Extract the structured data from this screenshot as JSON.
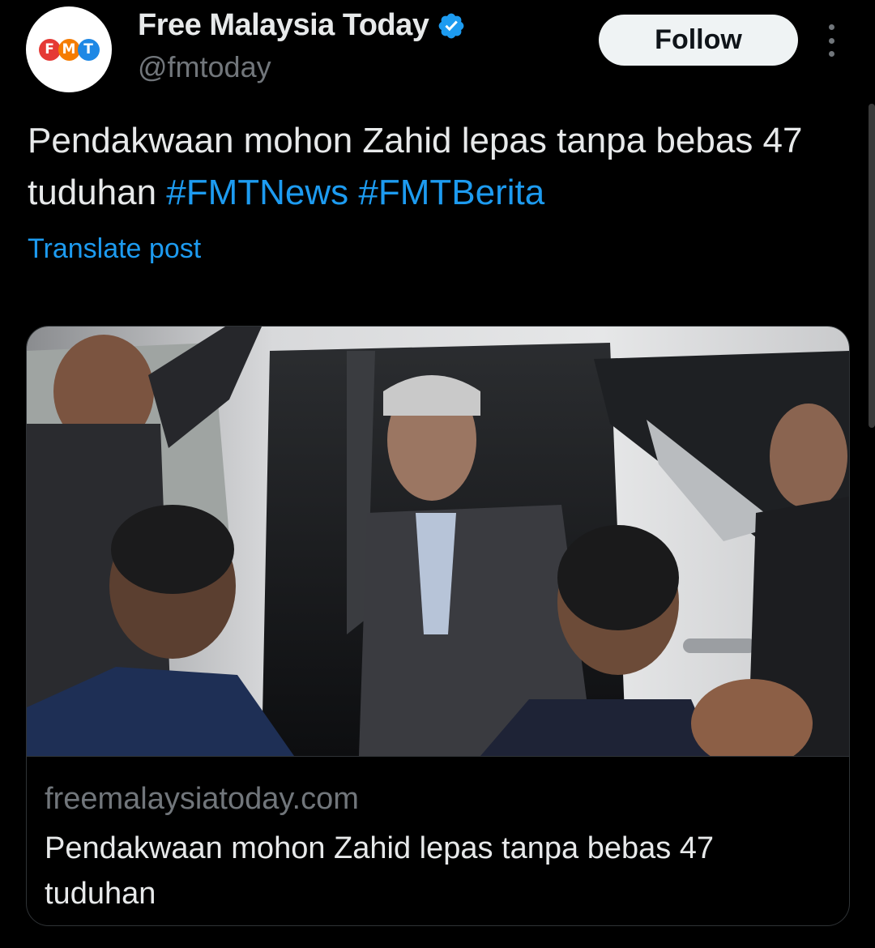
{
  "account": {
    "display_name": "Free Malaysia Today",
    "handle": "@fmtoday",
    "verified": true,
    "avatar_logo": [
      "F",
      "M",
      "T"
    ],
    "avatar_logo_colors": [
      "#e53935",
      "#f57c00",
      "#1e88e5"
    ]
  },
  "actions": {
    "follow_label": "Follow",
    "more_icon": "more-vertical-icon"
  },
  "post": {
    "text": "Pendakwaan mohon Zahid lepas tanpa bebas 47 tuduhan ",
    "hashtags": [
      "#FMTNews",
      "#FMTBerita"
    ],
    "translate_label": "Translate post"
  },
  "link_card": {
    "domain": "freemalaysiatoday.com",
    "title": "Pendakwaan mohon Zahid lepas tanpa bebas 47 tuduhan",
    "image_desc_icon": "news-photo-image"
  },
  "colors": {
    "background": "#000000",
    "text": "#e7e9ea",
    "muted": "#71767b",
    "accent": "#1d9bf0",
    "border": "#2f3336"
  }
}
